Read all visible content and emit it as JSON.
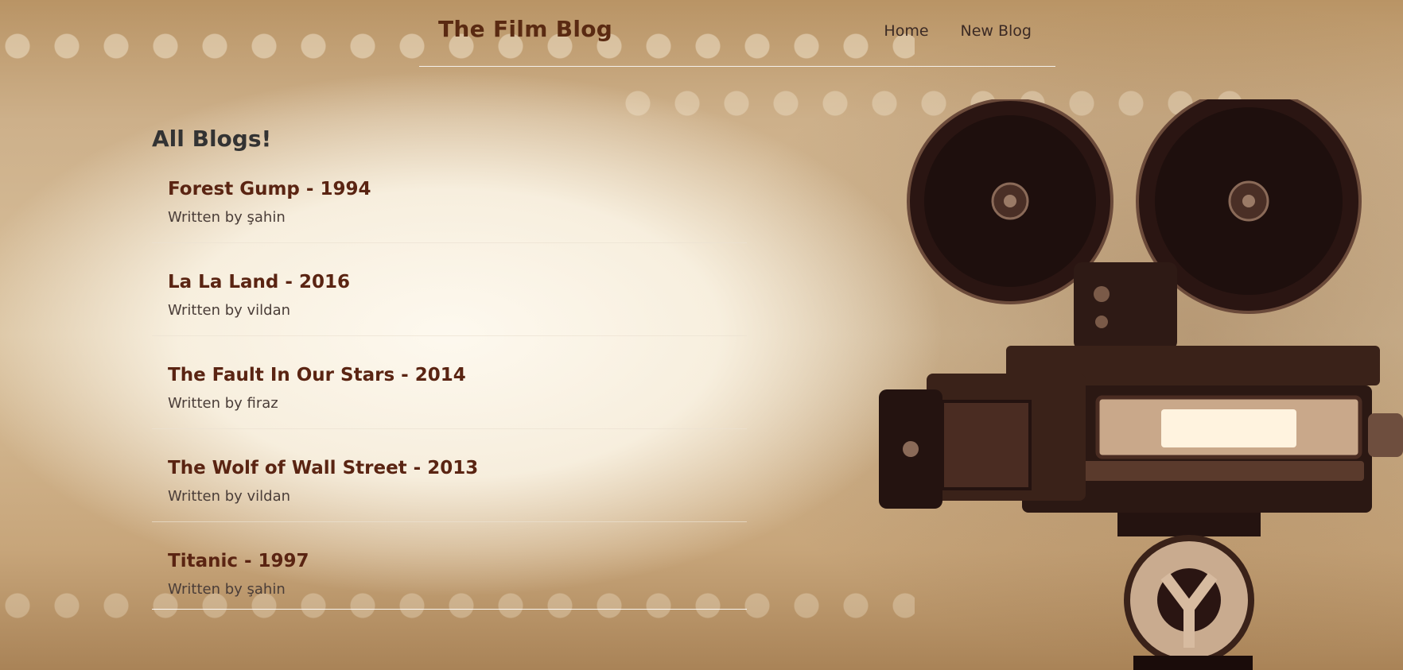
{
  "navbar": {
    "brand": "The Film Blog",
    "links": [
      "Home",
      "New Blog"
    ]
  },
  "page": {
    "title": "All Blogs!"
  },
  "blogs": [
    {
      "title": "Forest Gump - 1994",
      "author": "Written by şahin"
    },
    {
      "title": "La La Land - 2016",
      "author": "Written by vildan"
    },
    {
      "title": "The Fault In Our Stars - 2014",
      "author": "Written by firaz"
    },
    {
      "title": "The Wolf of Wall Street - 2013",
      "author": "Written by vildan"
    },
    {
      "title": "Titanic - 1997",
      "author": "Written by şahin"
    }
  ],
  "colors": {
    "brand": "#5a2a12",
    "blog_title": "#5a2412",
    "text": "#4a3d38"
  },
  "background": {
    "image_description_icon": "vintage-film-camera-icon"
  }
}
